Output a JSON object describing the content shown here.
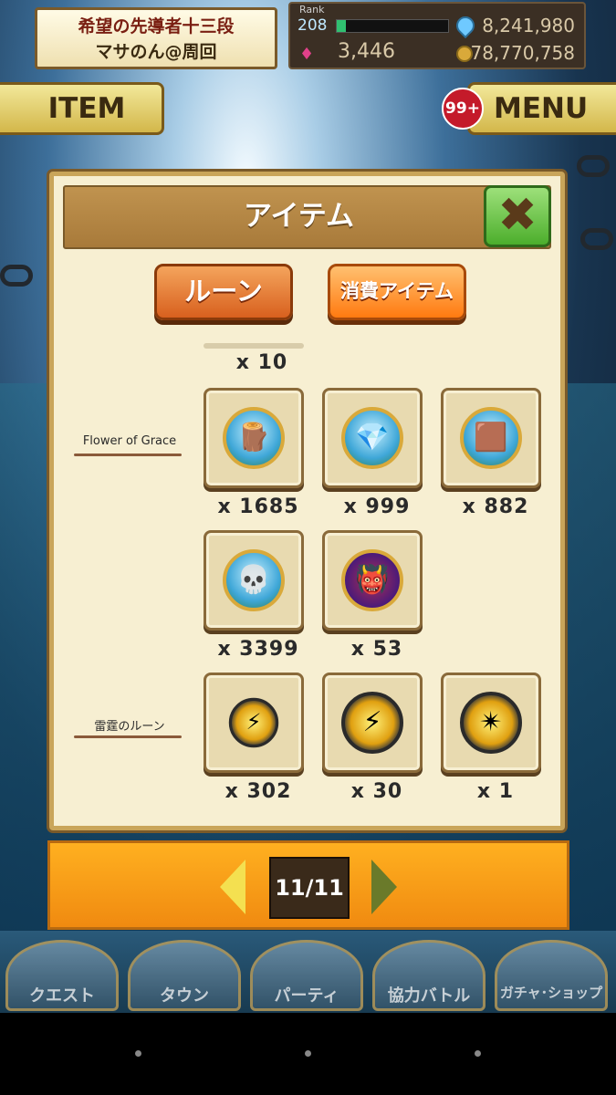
{
  "status": {
    "title_line1": "希望の先導者十三段",
    "title_line2": "マサのん@周回"
  },
  "resources": {
    "rank_label": "Rank",
    "rank_value": "208",
    "xp_progress": 0.08,
    "stones": "8,241,980",
    "gems": "3,446",
    "coins": "78,770,758"
  },
  "header_buttons": {
    "item_label": "ITEM",
    "menu_label": "MENU",
    "notification_badge": "99+"
  },
  "modal": {
    "title": "アイテム",
    "close_icon": "close-x-icon",
    "tabs": [
      {
        "label": "ルーン"
      },
      {
        "label": "消費アイテム"
      }
    ],
    "partial_row_count": "x 10",
    "sections": [
      {
        "label": "Flower of Grace",
        "items": [
          {
            "icon": "log-icon",
            "count": "x 1685"
          },
          {
            "icon": "crystal-icon",
            "count": "x 999"
          },
          {
            "icon": "hide-icon",
            "count": "x 882"
          },
          {
            "icon": "skull-icon",
            "count": "x 3399"
          },
          {
            "icon": "demon-mask-icon",
            "count": "x 53"
          }
        ]
      },
      {
        "label": "雷霆のルーン",
        "items": [
          {
            "icon": "thunder-rune-small-icon",
            "count": "x 302"
          },
          {
            "icon": "thunder-rune-medium-icon",
            "count": "x 30"
          },
          {
            "icon": "thunder-rune-large-icon",
            "count": "x 1"
          }
        ]
      }
    ]
  },
  "pagination": {
    "page": "11/11"
  },
  "bottom_nav": [
    {
      "label": "クエスト"
    },
    {
      "label": "タウン"
    },
    {
      "label": "パーティ"
    },
    {
      "label": "協力バトル"
    },
    {
      "label": "ガチャ･ショップ"
    }
  ],
  "colors": {
    "accent_orange": "#f08a10",
    "panel_cream": "#f7efd2",
    "close_green": "#4cae2c"
  }
}
